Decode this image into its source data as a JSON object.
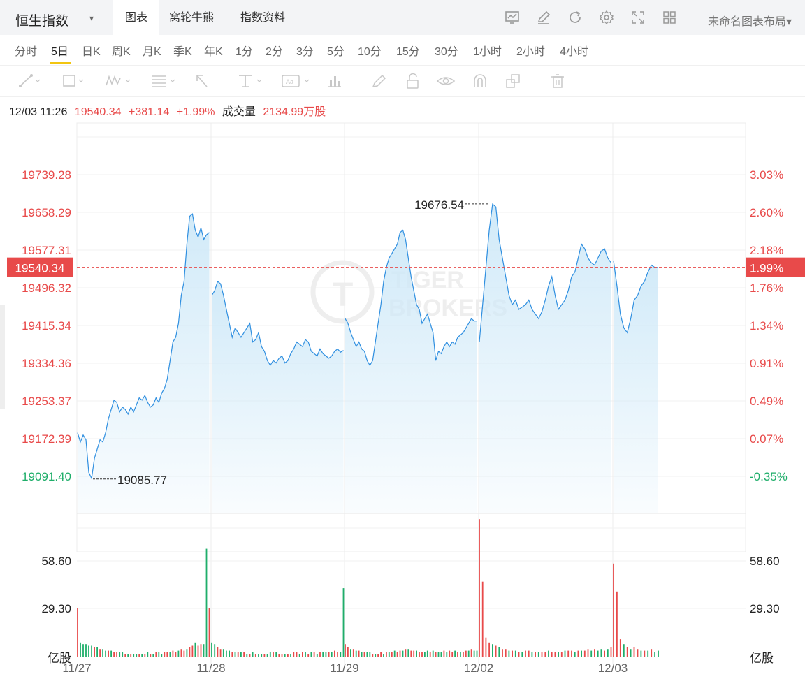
{
  "header": {
    "title": "恒生指数",
    "tabs": [
      "图表",
      "窝轮牛熊",
      "指数资料"
    ],
    "active_tab": 0,
    "tool_icons": [
      "chart-compare-icon",
      "draw-edit-icon",
      "refresh-icon",
      "settings-icon",
      "fullscreen-icon",
      "grid-layout-icon"
    ],
    "layout_label": "未命名图表布局▾"
  },
  "periods": {
    "items": [
      "分时",
      "5日",
      "日K",
      "周K",
      "月K",
      "季K",
      "年K",
      "1分",
      "2分",
      "3分",
      "5分",
      "10分",
      "15分",
      "30分",
      "1小时",
      "2小时",
      "4小时"
    ],
    "active": "5日"
  },
  "drawing_tools": [
    "trend-line-icon",
    "rectangle-icon",
    "pattern-icon",
    "fib-icon",
    "arrow-icon",
    "text-icon",
    "label-icon",
    "bar-icon",
    "brush-icon",
    "lock-icon",
    "eye-icon",
    "magnet-icon",
    "clone-icon",
    "trash-icon"
  ],
  "info": {
    "datetime": "12/03 11:26",
    "price": "19540.34",
    "change": "+381.14",
    "change_pct": "+1.99%",
    "volume_label": "成交量",
    "volume_value": "2134.99万股"
  },
  "watermark": [
    "TIGER",
    "BROKERS"
  ],
  "colors": {
    "up": "#e84a4a",
    "down": "#1fae6a",
    "line": "#2f8fe0",
    "area": "#d9eefa"
  },
  "chart_data": {
    "type": "area",
    "dates": [
      "11/27",
      "11/28",
      "11/29",
      "12/02",
      "12/03"
    ],
    "price_axis": {
      "ticks": [
        "19739.28",
        "19658.29",
        "19577.31",
        "19496.32",
        "19415.34",
        "19334.36",
        "19253.37",
        "19172.39",
        "19091.40"
      ],
      "tick_colors": [
        "#e84a4a",
        "#e84a4a",
        "#e84a4a",
        "#e84a4a",
        "#e84a4a",
        "#e84a4a",
        "#e84a4a",
        "#e84a4a",
        "#1fae6a"
      ],
      "pct_ticks": [
        "3.03%",
        "2.60%",
        "2.18%",
        "1.76%",
        "1.34%",
        "0.91%",
        "0.49%",
        "0.07%",
        "-0.35%"
      ],
      "ylim": [
        19050,
        19800
      ],
      "prev_close": 19159.2
    },
    "current": {
      "price": "19540.34",
      "pct": "1.99%",
      "value": 19540.34
    },
    "annotations": [
      {
        "label": "19676.54",
        "value": 19676.54,
        "day_index": 3.07
      },
      {
        "label": "19085.77",
        "value": 19085.77,
        "day_index": 0.12
      }
    ],
    "days": [
      {
        "points": [
          19185,
          19165,
          19180,
          19170,
          19100,
          19087,
          19130,
          19150,
          19170,
          19165,
          19185,
          19215,
          19235,
          19255,
          19250,
          19230,
          19240,
          19235,
          19225,
          19240,
          19230,
          19245,
          19260,
          19255,
          19265,
          19250,
          19240,
          19245,
          19260,
          19250,
          19270,
          19280,
          19300,
          19340,
          19380,
          19390,
          19420,
          19480,
          19510,
          19590,
          19650,
          19655,
          19620,
          19605,
          19625,
          19600,
          19610,
          19615
        ],
        "segments": [
          40
        ]
      },
      {
        "points": [
          19480,
          19490,
          19510,
          19505,
          19480,
          19450,
          19420,
          19390,
          19410,
          19400,
          19390,
          19400,
          19410,
          19420,
          19380,
          19385,
          19400,
          19370,
          19360,
          19340,
          19330,
          19340,
          19335,
          19345,
          19350,
          19335,
          19340,
          19355,
          19365,
          19380,
          19375,
          19370,
          19385,
          19380,
          19360,
          19355,
          19350,
          19365,
          19355,
          19350,
          19345,
          19350,
          19360,
          19365,
          19358,
          19362
        ],
        "segments": []
      },
      {
        "points": [
          19430,
          19420,
          19400,
          19385,
          19370,
          19380,
          19365,
          19360,
          19340,
          19330,
          19340,
          19380,
          19420,
          19460,
          19510,
          19540,
          19560,
          19570,
          19580,
          19590,
          19615,
          19620,
          19600,
          19560,
          19520,
          19490,
          19460,
          19450,
          19420,
          19430,
          19440,
          19420,
          19400,
          19340,
          19360,
          19355,
          19370,
          19380,
          19370,
          19380,
          19375,
          19390,
          19395,
          19400,
          19410,
          19420,
          19430,
          19425,
          19425
        ],
        "segments": []
      },
      {
        "points": [
          19380,
          19460,
          19540,
          19620,
          19676,
          19670,
          19600,
          19560,
          19520,
          19480,
          19460,
          19470,
          19450,
          19455,
          19460,
          19470,
          19450,
          19440,
          19430,
          19445,
          19470,
          19500,
          19520,
          19480,
          19450,
          19460,
          19470,
          19490,
          19520,
          19530,
          19560,
          19590,
          19580,
          19560,
          19550,
          19545,
          19560,
          19575,
          19580,
          19560,
          19550
        ],
        "segments": []
      },
      {
        "points": [
          19555,
          19500,
          19440,
          19410,
          19400,
          19430,
          19470,
          19480,
          19500,
          19510,
          19530,
          19545,
          19540,
          19540
        ],
        "segments": []
      }
    ],
    "volume": {
      "type": "bar",
      "ticks": [
        "58.60",
        "29.30"
      ],
      "unit": "亿股",
      "ylim": [
        0,
        88
      ],
      "days": [
        [
          30,
          9,
          8,
          8,
          7,
          7,
          6,
          6,
          5,
          5,
          4,
          4,
          4,
          3,
          3,
          3,
          3,
          2,
          2,
          2,
          2,
          2,
          2,
          2,
          2,
          3,
          2,
          2,
          3,
          3,
          2,
          3,
          3,
          3,
          4,
          3,
          4,
          5,
          4,
          5,
          6,
          7,
          9,
          7,
          8,
          8,
          66,
          30
        ],
        [
          9,
          8,
          6,
          5,
          5,
          4,
          4,
          3,
          3,
          3,
          3,
          3,
          2,
          2,
          3,
          2,
          2,
          2,
          2,
          2,
          3,
          3,
          3,
          2,
          2,
          2,
          2,
          2,
          3,
          3,
          2,
          3,
          3,
          2,
          3,
          3,
          2,
          3,
          3,
          3,
          3,
          3,
          4,
          3,
          3,
          42
        ],
        [
          8,
          6,
          5,
          5,
          4,
          4,
          3,
          3,
          3,
          3,
          2,
          2,
          2,
          3,
          2,
          3,
          3,
          3,
          4,
          3,
          4,
          4,
          5,
          5,
          4,
          4,
          4,
          3,
          3,
          3,
          4,
          3,
          4,
          3,
          3,
          3,
          4,
          3,
          4,
          3,
          4,
          3,
          3,
          3,
          4,
          4,
          5,
          4,
          4
        ],
        [
          84,
          46,
          12,
          9,
          8,
          7,
          6,
          5,
          5,
          4,
          4,
          4,
          3,
          3,
          4,
          4,
          3,
          3,
          3,
          3,
          3,
          4,
          3,
          3,
          3,
          3,
          4,
          4,
          4,
          3,
          4,
          4,
          4,
          5,
          4,
          5,
          4,
          5,
          4,
          5,
          6
        ],
        [
          57,
          40,
          11,
          8,
          6,
          5,
          6,
          5,
          4,
          4,
          4,
          5,
          3,
          4
        ]
      ],
      "colors_up_down": [
        [
          0,
          1,
          1,
          1,
          1,
          1,
          0,
          1,
          0,
          1,
          1,
          0,
          1,
          0,
          0,
          1,
          1,
          0,
          1,
          0,
          1,
          1,
          0,
          1,
          0,
          1,
          0,
          1,
          0,
          1,
          1,
          0,
          0,
          1,
          0,
          0,
          1,
          0,
          0,
          1,
          0,
          0,
          1,
          0,
          0,
          1,
          1,
          0
        ],
        [
          1,
          1,
          0,
          0,
          1,
          1,
          1,
          0,
          1,
          0,
          1,
          0,
          1,
          0,
          1,
          0,
          1,
          1,
          0,
          1,
          1,
          0,
          1,
          0,
          0,
          1,
          0,
          1,
          0,
          0,
          1,
          0,
          1,
          0,
          1,
          0,
          1,
          0,
          1,
          1,
          0,
          1,
          0,
          0,
          1,
          1
        ],
        [
          0,
          0,
          1,
          0,
          1,
          0,
          1,
          0,
          1,
          1,
          0,
          1,
          0,
          0,
          1,
          0,
          1,
          0,
          1,
          0,
          0,
          1,
          0,
          1,
          0,
          0,
          1,
          0,
          0,
          1,
          1,
          0,
          1,
          0,
          1,
          1,
          0,
          1,
          0,
          0,
          1,
          0,
          1,
          0,
          0,
          1,
          0,
          1,
          1
        ],
        [
          0,
          0,
          0,
          0,
          1,
          0,
          1,
          0,
          0,
          1,
          0,
          1,
          0,
          1,
          0,
          0,
          1,
          0,
          1,
          0,
          0,
          1,
          0,
          0,
          1,
          0,
          1,
          0,
          0,
          1,
          0,
          1,
          0,
          0,
          1,
          0,
          1,
          1,
          0,
          1,
          0
        ],
        [
          0,
          0,
          0,
          1,
          0,
          1,
          0,
          0,
          1,
          0,
          1,
          0,
          1,
          1
        ]
      ]
    }
  }
}
